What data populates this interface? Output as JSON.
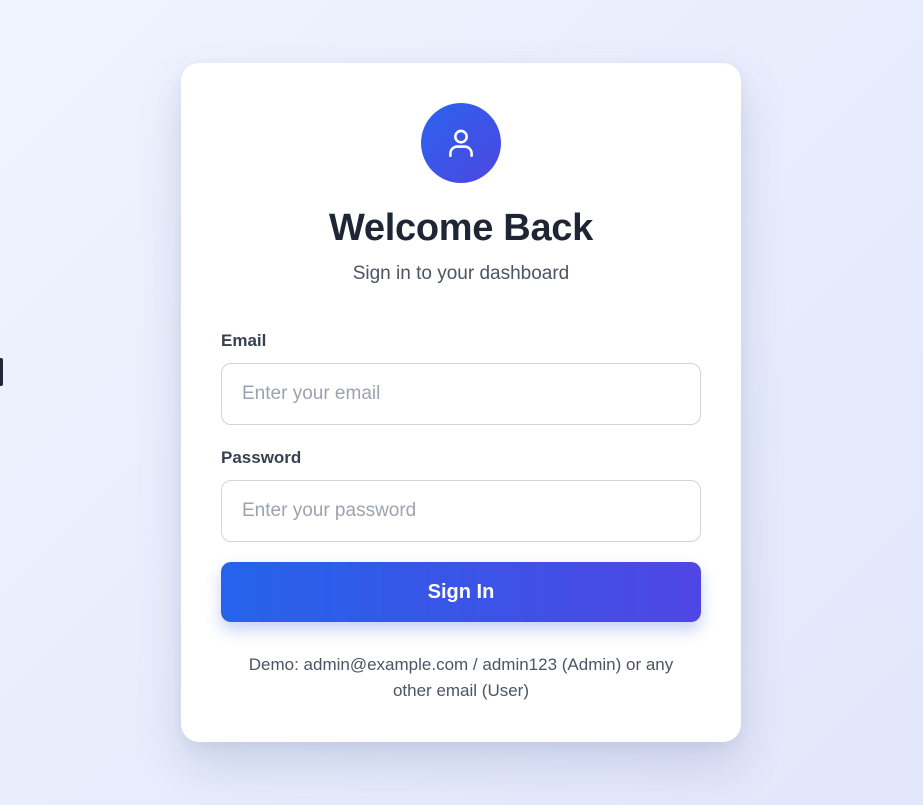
{
  "colors": {
    "accent_start": "#2563eb",
    "accent_end": "#4f46e5",
    "card_background": "#ffffff",
    "page_background": "#e8eefc",
    "title_text": "#1e2533"
  },
  "header": {
    "avatar_icon": "user-icon",
    "title": "Welcome Back",
    "subtitle": "Sign in to your dashboard"
  },
  "form": {
    "email": {
      "label": "Email",
      "value": "",
      "placeholder": "Enter your email"
    },
    "password": {
      "label": "Password",
      "value": "",
      "placeholder": "Enter your password"
    },
    "submit_label": "Sign In"
  },
  "footer": {
    "demo_text": "Demo: admin@example.com / admin123 (Admin) or any other email (User)"
  }
}
